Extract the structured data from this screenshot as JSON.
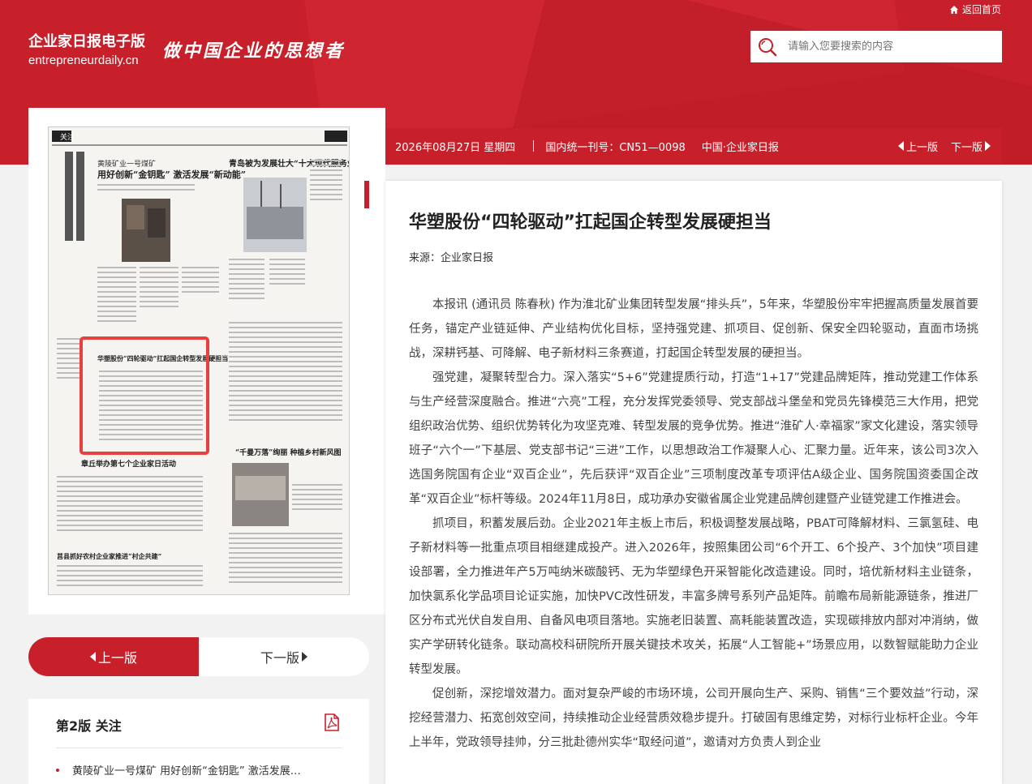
{
  "header": {
    "home_link": "返回首页",
    "brand_name": "企业家日报电子版",
    "brand_domain": "entrepreneurdaily.cn",
    "slogan": "做中国企业的思想者",
    "search_placeholder": "请输入您要搜索的内容"
  },
  "infobar": {
    "date": "2026年08月27日 星期四",
    "issn": "国内统一刊号：CN51—0098",
    "paper": "中国·企业家日报",
    "prev": "上一版",
    "next": "下一版"
  },
  "pager": {
    "prev": "上一版",
    "next": "下一版"
  },
  "edition": {
    "title": "第2版 关注",
    "items": [
      "黄陵矿业一号煤矿 用好创新“金钥匙” 激活发展…"
    ]
  },
  "article": {
    "title": "华塑股份“四轮驱动”扛起国企转型发展硬担当",
    "source": "来源：企业家日报",
    "paragraphs": [
      "本报讯 (通讯员 陈春秋) 作为淮北矿业集团转型发展“排头兵”，5年来，华塑股份牢牢把握高质量发展首要任务，锚定产业链延伸、产业结构优化目标，坚持强党建、抓项目、促创新、保安全四轮驱动，直面市场挑战，深耕钙基、可降解、电子新材料三条赛道，打起国企转型发展的硬担当。",
      "强党建，凝聚转型合力。深入落实“5+6”党建提质行动，打造“1+17”党建品牌矩阵，推动党建工作体系与生产经营深度融合。推进“六亮”工程，充分发挥党委领导、党支部战斗堡垒和党员先锋模范三大作用，把党组织政治优势、组织优势转化为攻坚克难、转型发展的竞争优势。推进“淮矿人·幸福家”家文化建设，落实领导班子“六个一”下基层、党支部书记“三进”工作，以思想政治工作凝聚人心、汇聚力量。近年来，该公司3次入选国务院国有企业“双百企业”，先后获评“双百企业”三项制度改革专项评估A级企业、国务院国资委国企改革“双百企业”标杆等级。2024年11月8日，成功承办安徽省属企业党建品牌创建暨产业链党建工作推进会。",
      "抓项目，积蓄发展后劲。企业2021年主板上市后，积极调整发展战略，PBAT可降解材料、三氯氢硅、电子新材料等一批重点项目相继建成投产。进入2026年，按照集团公司“6个开工、6个投产、3个加快”项目建设部署，全力推进年产5万吨纳米碳酸钙、无为华塑绿色开采智能化改造建设。同时，培优新材料主业链条，加快氯系化学品项目论证实施，加快PVC改性研发，丰富多牌号系列产品矩阵。前瞻布局新能源链条，推进厂区分布式光伏自发自用、自备风电项目落地。实施老旧装置、高耗能装置改造，实现碳排放内部对冲消纳，做实产学研转化链条。联动高校科研院所开展关键技术攻关，拓展“人工智能+”场景应用，以数智赋能助力企业转型发展。",
      "促创新，深挖增效潜力。面对复杂严峻的市场环境，公司开展向生产、采购、销售“三个要效益”行动，深挖经营潜力、拓宽创效空间，持续推动企业经营质效稳步提升。打破固有思维定势，对标行业标杆企业。今年上半年，党政领导挂帅，分三批赴德州实华“取经问道”，邀请对方负责人到企业"
    ]
  },
  "colors": {
    "brand_red": "#c8202b",
    "page_bg": "#f2f2f2"
  }
}
